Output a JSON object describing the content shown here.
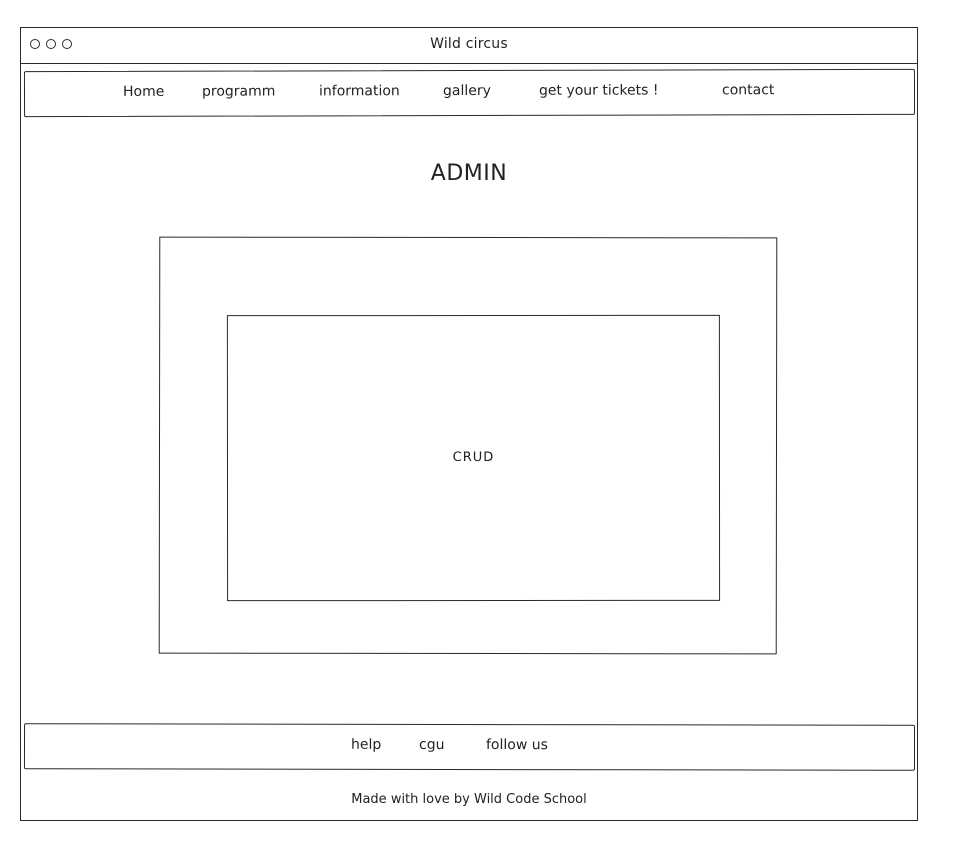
{
  "window": {
    "title": "Wild circus"
  },
  "nav": {
    "items": [
      {
        "label": "Home"
      },
      {
        "label": "programm"
      },
      {
        "label": "information"
      },
      {
        "label": "gallery"
      },
      {
        "label": "get your tickets !"
      },
      {
        "label": "contact"
      }
    ]
  },
  "main": {
    "title": "ADMIN",
    "panel_label": "CRUD"
  },
  "footer": {
    "links": [
      {
        "label": "help"
      },
      {
        "label": "cgu"
      },
      {
        "label": "follow us"
      }
    ],
    "credit": "Made with love by Wild Code School"
  },
  "colors": {
    "stroke": "#2a2a2a",
    "background": "#ffffff"
  }
}
